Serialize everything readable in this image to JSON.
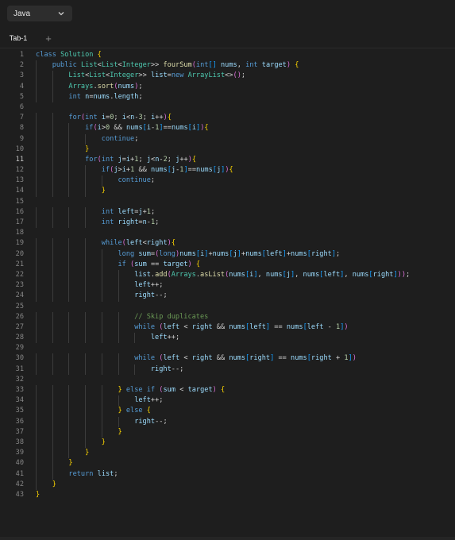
{
  "toolbar": {
    "language": "Java",
    "chevron_icon": "chevron-down-icon"
  },
  "tabs": [
    {
      "label": "Tab-1"
    }
  ],
  "tab_add_label": "+",
  "editor": {
    "active_line": 11,
    "lines": [
      "class Solution {",
      "    public List<List<Integer>> fourSum(int[] nums, int target) {",
      "        List<List<Integer>> list=new ArrayList<>();",
      "        Arrays.sort(nums);",
      "        int n=nums.length;",
      "",
      "        for(int i=0; i<n-3; i++){",
      "            if(i>0 && nums[i-1]==nums[i]){",
      "                continue;",
      "            }",
      "            for(int j=i+1; j<n-2; j++){",
      "                if(j>i+1 && nums[j-1]==nums[j]){",
      "                    continue;",
      "                }",
      "",
      "                int left=j+1;",
      "                int right=n-1;",
      "",
      "                while(left<right){",
      "                    long sum=(long)nums[i]+nums[j]+nums[left]+nums[right];",
      "                    if (sum == target) {",
      "                        list.add(Arrays.asList(nums[i], nums[j], nums[left], nums[right]));",
      "                        left++;",
      "                        right--;",
      "",
      "                        // Skip duplicates",
      "                        while (left < right && nums[left] == nums[left - 1])",
      "                            left++;",
      "",
      "                        while (left < right && nums[right] == nums[right + 1])",
      "                            right--;",
      "",
      "                    } else if (sum < target) {",
      "                        left++;",
      "                    } else {",
      "                        right--;",
      "                    }",
      "                }",
      "            }",
      "        }",
      "        return list;",
      "    }",
      "}"
    ]
  }
}
